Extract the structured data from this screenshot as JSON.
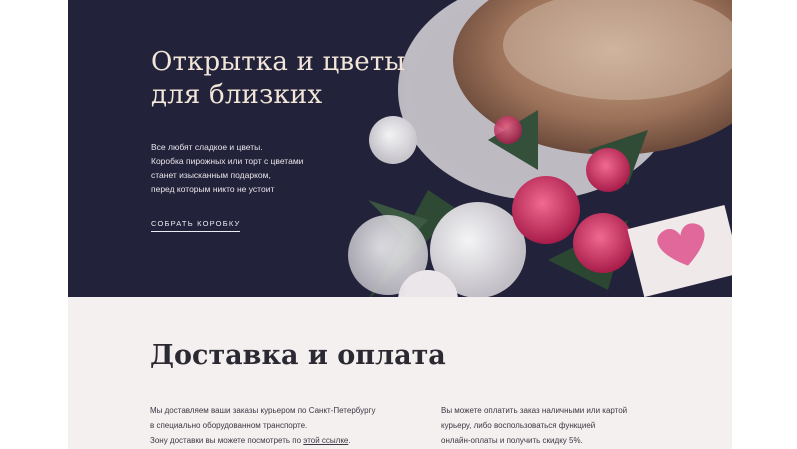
{
  "hero": {
    "title_line1": "Открытка и цветы",
    "title_line2": "для близких",
    "text_lines": [
      "Все любят сладкое и цветы.",
      "Коробка пирожных или торт с цветами",
      "станет изысканным подарком,",
      "перед которым никто не устоит"
    ],
    "cta_label": "СОБРАТЬ КОРОБКУ"
  },
  "delivery": {
    "title": "Доставка и оплата",
    "left_lines": [
      "Мы доставляем ваши заказы курьером по Санкт-Петербургу",
      "в специально оборудованном транспорте."
    ],
    "left_last_prefix": "Зону доставки вы можете посмотреть по ",
    "left_link": "этой ссылке",
    "left_last_suffix": ".",
    "right_lines": [
      "Вы можете оплатить заказ наличными или картой",
      "курьеру, либо воспользоваться функцией",
      "онлайн-оплаты и получить скидку 5%."
    ]
  },
  "colors": {
    "hero_bg": "#22223a",
    "page_bg": "#f4f0f0",
    "title_cream": "#f2e6d8",
    "rose_pink": "#d8426e",
    "heart_pink": "#e0689a"
  }
}
